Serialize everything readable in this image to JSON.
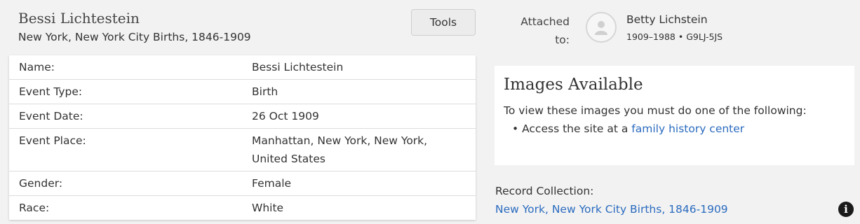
{
  "record": {
    "name": "Bessi Lichtestein",
    "collection": "New York, New York City Births, 1846-1909",
    "tools_label": "Tools"
  },
  "fields": [
    {
      "label": "Name:",
      "value": "Bessi Lichtestein"
    },
    {
      "label": "Event Type:",
      "value": "Birth"
    },
    {
      "label": "Event Date:",
      "value": "26 Oct 1909"
    },
    {
      "label": "Event Place:",
      "value": "Manhattan, New York, New York, United States"
    },
    {
      "label": "Gender:",
      "value": "Female"
    },
    {
      "label": "Race:",
      "value": "White"
    }
  ],
  "attached": {
    "label_line1": "Attached",
    "label_line2": "to:",
    "person_name": "Betty Lichstein",
    "person_meta": "1909–1988 • G9LJ-5JS",
    "avatar_icon": "person-silhouette-icon"
  },
  "images": {
    "title": "Images Available",
    "description": "To view these images you must do one of the following:",
    "bullet_prefix": "Access the site at a ",
    "bullet_link": "family history center"
  },
  "record_collection": {
    "label": "Record Collection:",
    "link": "New York, New York City Births, 1846-1909",
    "info_icon": "info-icon"
  },
  "colors": {
    "link": "#2a6bbf",
    "background": "#f2f2f2"
  }
}
